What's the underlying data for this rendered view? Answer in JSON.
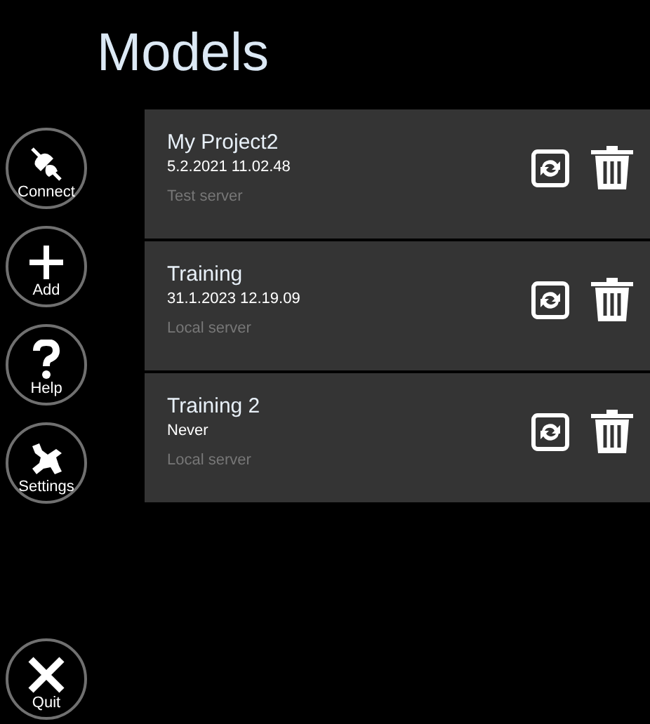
{
  "title": "Models",
  "nav": [
    {
      "kind": "connect",
      "label": "Connect"
    },
    {
      "kind": "add",
      "label": "Add"
    },
    {
      "kind": "help",
      "label": "Help"
    },
    {
      "kind": "settings",
      "label": "Settings"
    }
  ],
  "quit": {
    "kind": "quit",
    "label": "Quit"
  },
  "models": [
    {
      "name": "My Project2",
      "date": "5.2.2021 11.02.48",
      "server": "Test server"
    },
    {
      "name": "Training",
      "date": "31.1.2023 12.19.09",
      "server": "Local server"
    },
    {
      "name": "Training 2",
      "date": "Never",
      "server": "Local server"
    }
  ]
}
